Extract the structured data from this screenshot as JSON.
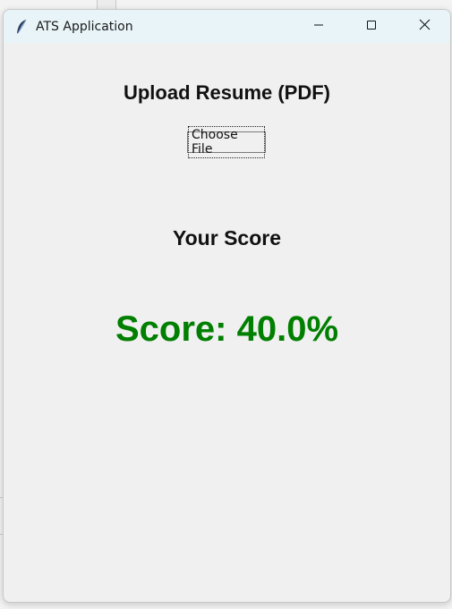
{
  "window": {
    "title": "ATS Application",
    "icon": "feather-icon",
    "controls": [
      "minimize-icon",
      "maximize-icon",
      "close-icon"
    ]
  },
  "main": {
    "heading": "Upload Resume (PDF)",
    "choose_file_label": "Choose File",
    "score_heading": "Your Score",
    "score_text": "Score: 40.0%",
    "score_value": 40.0,
    "score_color": "#007f00"
  }
}
